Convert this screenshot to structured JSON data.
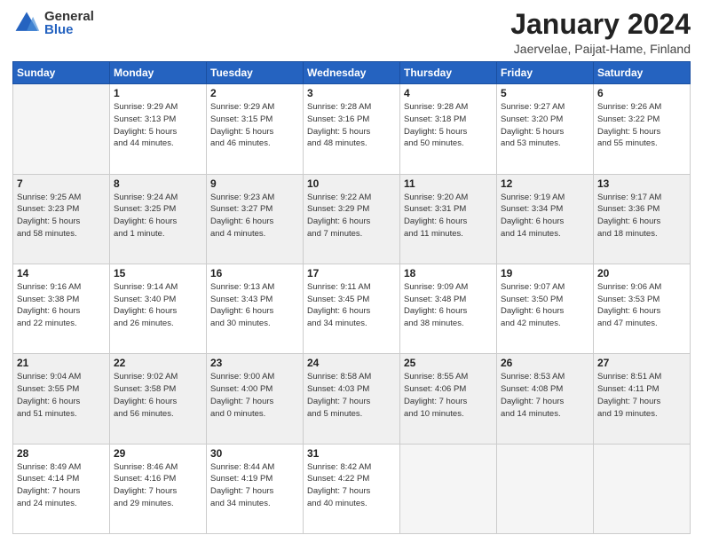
{
  "logo": {
    "general": "General",
    "blue": "Blue"
  },
  "title": "January 2024",
  "location": "Jaervelae, Paijat-Hame, Finland",
  "days_header": [
    "Sunday",
    "Monday",
    "Tuesday",
    "Wednesday",
    "Thursday",
    "Friday",
    "Saturday"
  ],
  "weeks": [
    [
      {
        "num": "",
        "info": ""
      },
      {
        "num": "1",
        "info": "Sunrise: 9:29 AM\nSunset: 3:13 PM\nDaylight: 5 hours\nand 44 minutes."
      },
      {
        "num": "2",
        "info": "Sunrise: 9:29 AM\nSunset: 3:15 PM\nDaylight: 5 hours\nand 46 minutes."
      },
      {
        "num": "3",
        "info": "Sunrise: 9:28 AM\nSunset: 3:16 PM\nDaylight: 5 hours\nand 48 minutes."
      },
      {
        "num": "4",
        "info": "Sunrise: 9:28 AM\nSunset: 3:18 PM\nDaylight: 5 hours\nand 50 minutes."
      },
      {
        "num": "5",
        "info": "Sunrise: 9:27 AM\nSunset: 3:20 PM\nDaylight: 5 hours\nand 53 minutes."
      },
      {
        "num": "6",
        "info": "Sunrise: 9:26 AM\nSunset: 3:22 PM\nDaylight: 5 hours\nand 55 minutes."
      }
    ],
    [
      {
        "num": "7",
        "info": "Sunrise: 9:25 AM\nSunset: 3:23 PM\nDaylight: 5 hours\nand 58 minutes."
      },
      {
        "num": "8",
        "info": "Sunrise: 9:24 AM\nSunset: 3:25 PM\nDaylight: 6 hours\nand 1 minute."
      },
      {
        "num": "9",
        "info": "Sunrise: 9:23 AM\nSunset: 3:27 PM\nDaylight: 6 hours\nand 4 minutes."
      },
      {
        "num": "10",
        "info": "Sunrise: 9:22 AM\nSunset: 3:29 PM\nDaylight: 6 hours\nand 7 minutes."
      },
      {
        "num": "11",
        "info": "Sunrise: 9:20 AM\nSunset: 3:31 PM\nDaylight: 6 hours\nand 11 minutes."
      },
      {
        "num": "12",
        "info": "Sunrise: 9:19 AM\nSunset: 3:34 PM\nDaylight: 6 hours\nand 14 minutes."
      },
      {
        "num": "13",
        "info": "Sunrise: 9:17 AM\nSunset: 3:36 PM\nDaylight: 6 hours\nand 18 minutes."
      }
    ],
    [
      {
        "num": "14",
        "info": "Sunrise: 9:16 AM\nSunset: 3:38 PM\nDaylight: 6 hours\nand 22 minutes."
      },
      {
        "num": "15",
        "info": "Sunrise: 9:14 AM\nSunset: 3:40 PM\nDaylight: 6 hours\nand 26 minutes."
      },
      {
        "num": "16",
        "info": "Sunrise: 9:13 AM\nSunset: 3:43 PM\nDaylight: 6 hours\nand 30 minutes."
      },
      {
        "num": "17",
        "info": "Sunrise: 9:11 AM\nSunset: 3:45 PM\nDaylight: 6 hours\nand 34 minutes."
      },
      {
        "num": "18",
        "info": "Sunrise: 9:09 AM\nSunset: 3:48 PM\nDaylight: 6 hours\nand 38 minutes."
      },
      {
        "num": "19",
        "info": "Sunrise: 9:07 AM\nSunset: 3:50 PM\nDaylight: 6 hours\nand 42 minutes."
      },
      {
        "num": "20",
        "info": "Sunrise: 9:06 AM\nSunset: 3:53 PM\nDaylight: 6 hours\nand 47 minutes."
      }
    ],
    [
      {
        "num": "21",
        "info": "Sunrise: 9:04 AM\nSunset: 3:55 PM\nDaylight: 6 hours\nand 51 minutes."
      },
      {
        "num": "22",
        "info": "Sunrise: 9:02 AM\nSunset: 3:58 PM\nDaylight: 6 hours\nand 56 minutes."
      },
      {
        "num": "23",
        "info": "Sunrise: 9:00 AM\nSunset: 4:00 PM\nDaylight: 7 hours\nand 0 minutes."
      },
      {
        "num": "24",
        "info": "Sunrise: 8:58 AM\nSunset: 4:03 PM\nDaylight: 7 hours\nand 5 minutes."
      },
      {
        "num": "25",
        "info": "Sunrise: 8:55 AM\nSunset: 4:06 PM\nDaylight: 7 hours\nand 10 minutes."
      },
      {
        "num": "26",
        "info": "Sunrise: 8:53 AM\nSunset: 4:08 PM\nDaylight: 7 hours\nand 14 minutes."
      },
      {
        "num": "27",
        "info": "Sunrise: 8:51 AM\nSunset: 4:11 PM\nDaylight: 7 hours\nand 19 minutes."
      }
    ],
    [
      {
        "num": "28",
        "info": "Sunrise: 8:49 AM\nSunset: 4:14 PM\nDaylight: 7 hours\nand 24 minutes."
      },
      {
        "num": "29",
        "info": "Sunrise: 8:46 AM\nSunset: 4:16 PM\nDaylight: 7 hours\nand 29 minutes."
      },
      {
        "num": "30",
        "info": "Sunrise: 8:44 AM\nSunset: 4:19 PM\nDaylight: 7 hours\nand 34 minutes."
      },
      {
        "num": "31",
        "info": "Sunrise: 8:42 AM\nSunset: 4:22 PM\nDaylight: 7 hours\nand 40 minutes."
      },
      {
        "num": "",
        "info": ""
      },
      {
        "num": "",
        "info": ""
      },
      {
        "num": "",
        "info": ""
      }
    ]
  ]
}
